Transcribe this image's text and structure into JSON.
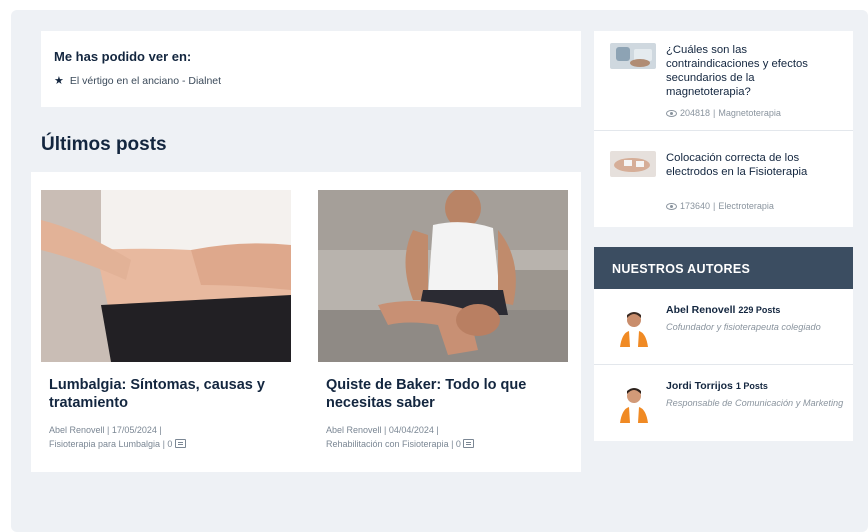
{
  "seen_in": {
    "title": "Me has podido ver en:",
    "items": [
      {
        "label": "El vértigo en el anciano - Dialnet",
        "icon": "star-icon"
      }
    ]
  },
  "latest_posts": {
    "heading": "Últimos posts",
    "posts": [
      {
        "title": "Lumbalgia: Síntomas, causas y tratamiento",
        "meta_line1": "Abel Renovell | 17/05/2024 |",
        "meta_line2": "Fisioterapia para Lumbalgia | 0"
      },
      {
        "title": "Quiste de Baker: Todo lo que necesitas saber",
        "meta_line1": "Abel Renovell | 04/04/2024 |",
        "meta_line2": "Rehabilitación con Fisioterapia | 0"
      }
    ]
  },
  "popular": {
    "items": [
      {
        "title": "¿Cuáles son las contraindicaciones y efectos secundarios de la magnetoterapia?",
        "views": "204818",
        "category": "Magnetoterapia"
      },
      {
        "title": "Colocación correcta de los electrodos en la Fisioterapia",
        "views": "173640",
        "category": "Electroterapia"
      }
    ]
  },
  "authors": {
    "heading": "NUESTROS AUTORES",
    "list": [
      {
        "name": "Abel Renovell",
        "posts": "229 Posts",
        "role": "Cofundador y fisioterapeuta colegiado"
      },
      {
        "name": "Jordi Torrijos",
        "posts": "1 Posts",
        "role": "Responsable de Comunicación y Marketing"
      }
    ]
  },
  "colors": {
    "page_bg": "#eef1f5",
    "heading": "#13263f",
    "authors_header": "#3b4d61",
    "meta": "#7b8794"
  }
}
